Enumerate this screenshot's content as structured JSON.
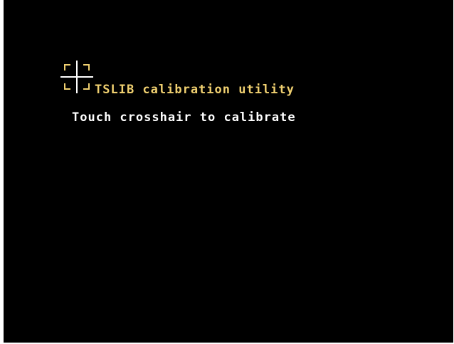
{
  "screen": {
    "title": "TSLIB calibration utility",
    "instruction": "Touch crosshair to calibrate"
  },
  "crosshair": {
    "icon": "crosshair-icon"
  },
  "colors": {
    "background": "#000000",
    "title": "#f0d070",
    "instruction": "#ffffff",
    "crosshair": "#ffffff",
    "crosshair_brackets": "#f0d070"
  }
}
